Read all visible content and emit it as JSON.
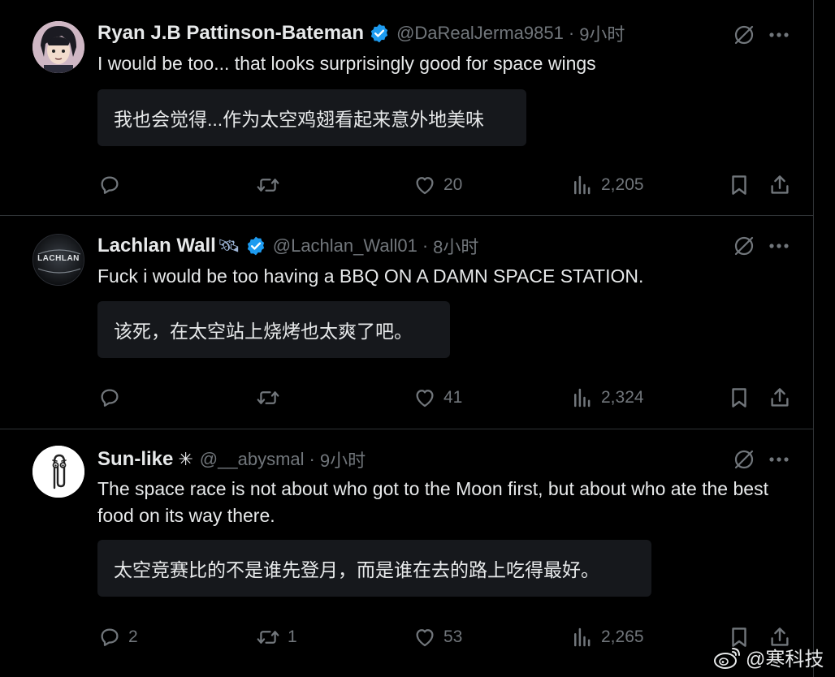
{
  "colors": {
    "background": "#000000",
    "text": "#e7e9ea",
    "muted": "#71767b",
    "verified": "#1d9bf0",
    "translation_bg": "#16181c"
  },
  "tweets": [
    {
      "name": "Ryan J.B Pattinson-Bateman",
      "verified": true,
      "handle": "@DaRealJerma9851",
      "dot": "·",
      "time": "9小时",
      "text": "I would be too... that looks surprisingly good for space wings",
      "translation": "我也会觉得...作为太空鸡翅看起来意外地美味",
      "replies": "",
      "reposts": "",
      "likes": "20",
      "views": "2,205"
    },
    {
      "name": "Lachlan Wall",
      "name_emoji": "🛰",
      "verified": true,
      "handle": "@Lachlan_Wall01",
      "dot": "·",
      "time": "8小时",
      "avatar_text": "LACHLAN",
      "text": "Fuck i would be too having a BBQ ON A DAMN SPACE STATION.",
      "translation": "该死，在太空站上烧烤也太爽了吧。",
      "replies": "",
      "reposts": "",
      "likes": "41",
      "views": "2,324"
    },
    {
      "name": "Sun-like",
      "name_emoji": "✳",
      "verified": false,
      "handle": "@__abysmal",
      "dot": "·",
      "time": "9小时",
      "text": "The space race is not about who got to the Moon first, but about who ate the best food on its way there.",
      "translation": "太空竞赛比的不是谁先登月，而是谁在去的路上吃得最好。",
      "replies": "2",
      "reposts": "1",
      "likes": "53",
      "views": "2,265"
    }
  ],
  "watermark": {
    "icon": "weibo-icon",
    "text": "@寒科技"
  }
}
